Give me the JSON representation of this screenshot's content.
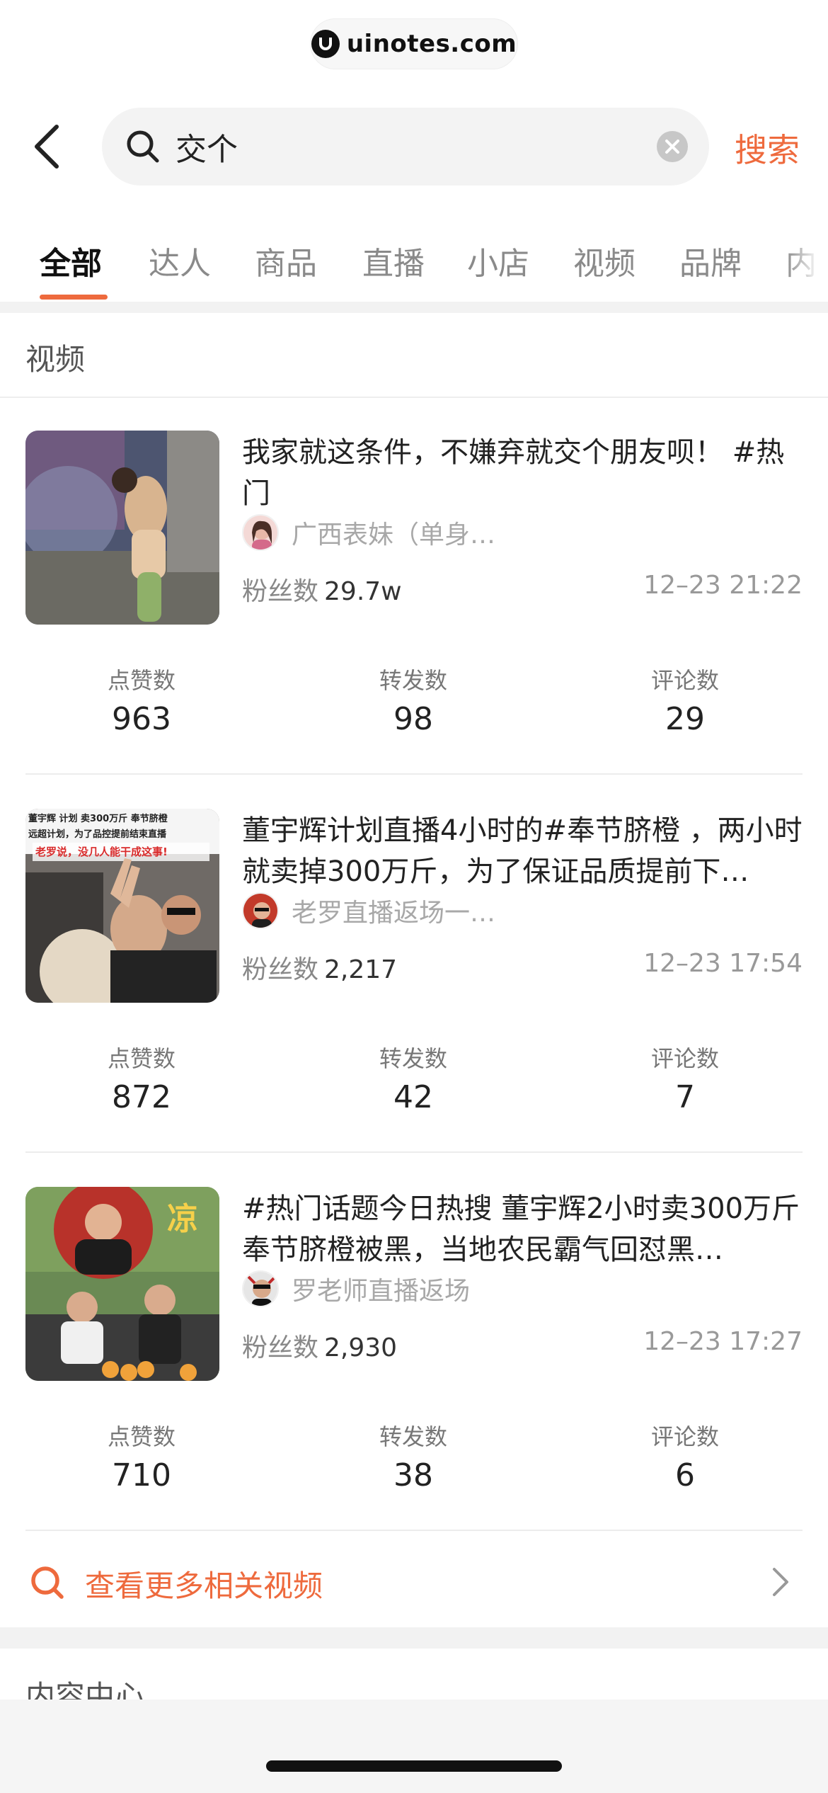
{
  "watermark": {
    "text": "uinotes.com"
  },
  "search": {
    "query": "交个",
    "button_label": "搜索"
  },
  "tabs": [
    {
      "label": "全部",
      "active": true
    },
    {
      "label": "达人",
      "active": false
    },
    {
      "label": "商品",
      "active": false
    },
    {
      "label": "直播",
      "active": false
    },
    {
      "label": "小店",
      "active": false
    },
    {
      "label": "视频",
      "active": false
    },
    {
      "label": "品牌",
      "active": false
    },
    {
      "label": "内",
      "active": false
    }
  ],
  "section": {
    "title": "视频"
  },
  "stat_labels": {
    "likes": "点赞数",
    "shares": "转发数",
    "comments": "评论数"
  },
  "videos": [
    {
      "title": "我家就这条件，不嫌弃就交个朋友呗！ #热门",
      "author": "广西表妹（单身…",
      "fans_label": "粉丝数",
      "fans": "29.7w",
      "time": "12–23 21:22",
      "likes": "963",
      "shares": "98",
      "comments": "29"
    },
    {
      "title": "董宇辉计划直播4小时的#奉节脐橙 ，两小时就卖掉300万斤，为了保证品质提前下…",
      "author": "老罗直播返场一…",
      "fans_label": "粉丝数",
      "fans": "2,217",
      "time": "12–23 17:54",
      "likes": "872",
      "shares": "42",
      "comments": "7"
    },
    {
      "title": "#热门话题今日热搜 董宇辉2小时卖300万斤奉节脐橙被黑，当地农民霸气回怼黑…",
      "author": "罗老师直播返场",
      "fans_label": "粉丝数",
      "fans": "2,930",
      "time": "12–23 17:27",
      "likes": "710",
      "shares": "38",
      "comments": "6"
    }
  ],
  "thumb_texts": {
    "v2_line1": "董宇辉 计划 卖300万斤 奉节脐橙",
    "v2_line2": "远超计划，为了品控提前结束直播",
    "v2_line3": "老罗说，没几人能干成这事!",
    "v3_tag": "凉"
  },
  "more_videos": {
    "label": "查看更多相关视频"
  },
  "next_section": {
    "title": "内容中心"
  },
  "colors": {
    "accent": "#ee6a3d",
    "divider": "#f2f2f2"
  }
}
